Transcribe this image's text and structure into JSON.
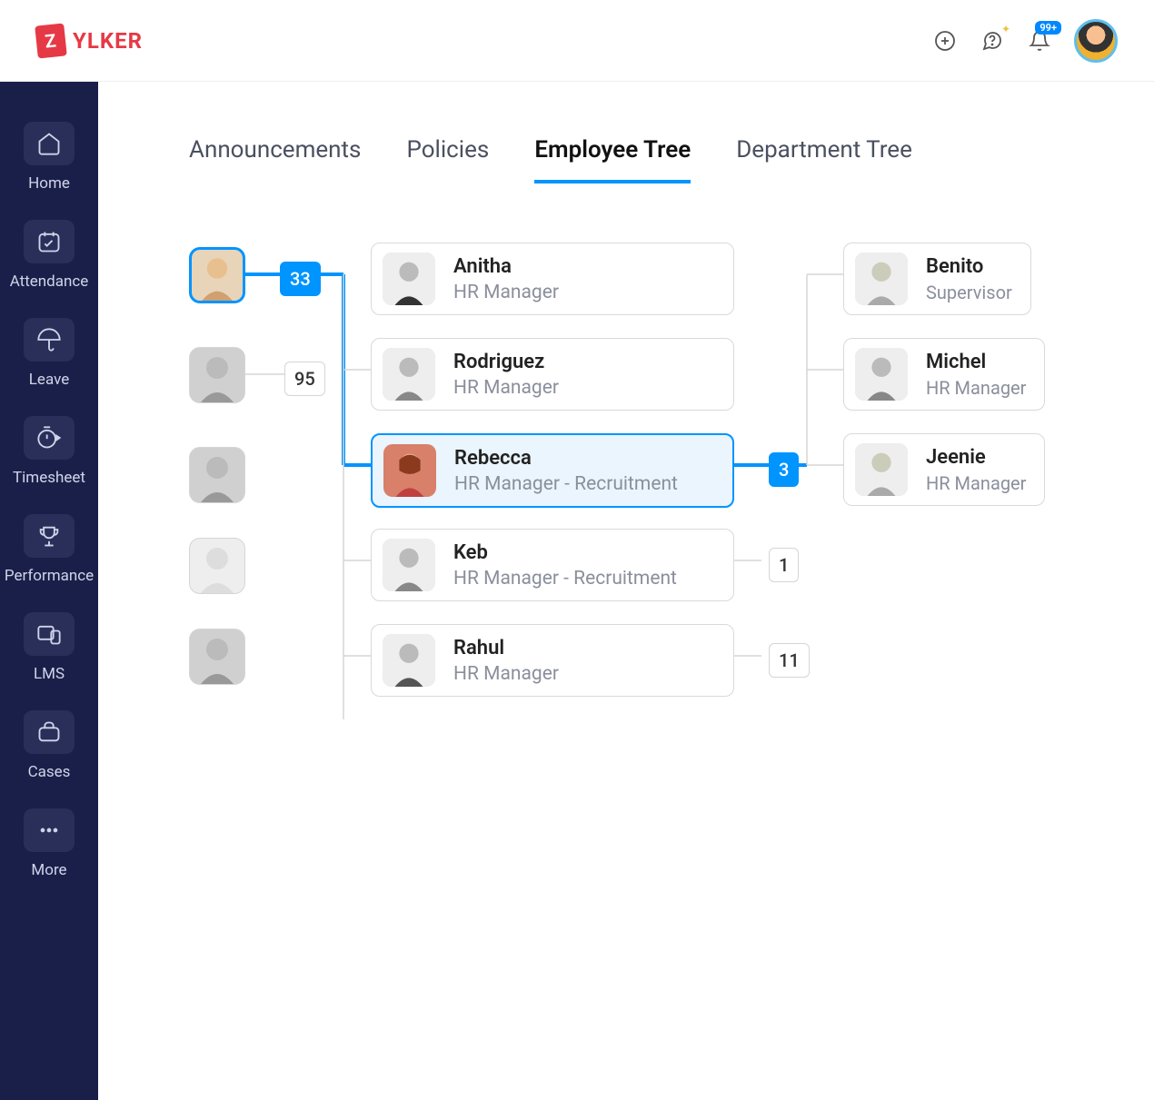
{
  "logo": {
    "badge": "Z",
    "text": "YLKER"
  },
  "header": {
    "notification_count": "99+"
  },
  "sidebar": {
    "items": [
      {
        "label": "Home",
        "icon": "home"
      },
      {
        "label": "Attendance",
        "icon": "calendar"
      },
      {
        "label": "Leave",
        "icon": "umbrella"
      },
      {
        "label": "Timesheet",
        "icon": "timer"
      },
      {
        "label": "Performance",
        "icon": "trophy"
      },
      {
        "label": "LMS",
        "icon": "devices"
      },
      {
        "label": "Cases",
        "icon": "briefcase"
      },
      {
        "label": "More",
        "icon": "more"
      }
    ]
  },
  "tabs": [
    {
      "label": "Announcements",
      "active": false
    },
    {
      "label": "Policies",
      "active": false
    },
    {
      "label": "Employee Tree",
      "active": true
    },
    {
      "label": "Department Tree",
      "active": false
    }
  ],
  "tree": {
    "root_count": "33",
    "other_counts": [
      "95"
    ],
    "level2": [
      {
        "name": "Anitha",
        "role": "HR Manager",
        "count": null,
        "highlight": false
      },
      {
        "name": "Rodriguez",
        "role": "HR Manager",
        "count": null,
        "highlight": false
      },
      {
        "name": "Rebecca",
        "role": "HR Manager - Recruitment",
        "count": "3",
        "highlight": true
      },
      {
        "name": "Keb",
        "role": "HR Manager - Recruitment",
        "count": "1",
        "highlight": false
      },
      {
        "name": "Rahul",
        "role": "HR Manager",
        "count": "11",
        "highlight": false
      }
    ],
    "level3": [
      {
        "name": "Benito",
        "role": "Supervisor"
      },
      {
        "name": "Michel",
        "role": "HR Manager"
      },
      {
        "name": "Jeenie",
        "role": "HR Manager"
      }
    ]
  }
}
